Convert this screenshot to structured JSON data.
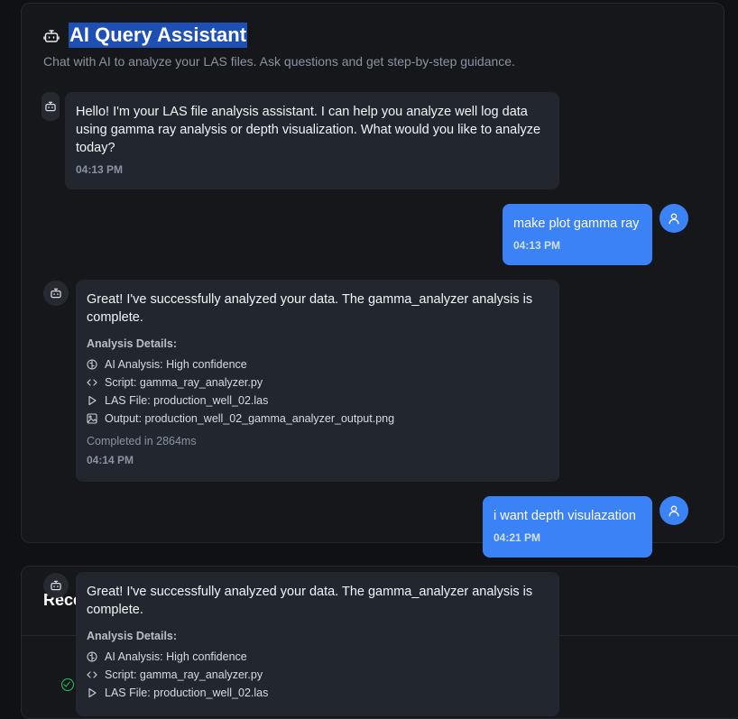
{
  "header": {
    "title": "AI Query Assistant",
    "subtitle": "Chat with AI to analyze your LAS files. Ask questions and get step-by-step guidance."
  },
  "messages": [
    {
      "role": "assistant",
      "text": "Hello! I'm your LAS file analysis assistant. I can help you analyze well log data using gamma ray analysis or depth visualization. What would you like to analyze today?",
      "time": "04:13 PM"
    },
    {
      "role": "user",
      "text": "make plot gamma ray",
      "time": "04:13 PM"
    },
    {
      "role": "assistant",
      "text": "Great! I've successfully analyzed your data. The gamma_analyzer analysis is complete.",
      "details_heading": "Analysis Details:",
      "details": [
        {
          "icon": "brain-icon",
          "label": "AI Analysis: High confidence"
        },
        {
          "icon": "code-icon",
          "label": "Script: gamma_ray_analyzer.py"
        },
        {
          "icon": "play-icon",
          "label": "LAS File: production_well_02.las"
        },
        {
          "icon": "image-icon",
          "label": "Output: production_well_02_gamma_analyzer_output.png"
        }
      ],
      "completed": "Completed in 2864ms",
      "time": "04:14 PM"
    },
    {
      "role": "user",
      "text": "i want depth visulazation",
      "time": "04:21 PM"
    },
    {
      "role": "assistant",
      "text": "Great! I've successfully analyzed your data. The gamma_analyzer analysis is complete.",
      "details_heading": "Analysis Details:",
      "details": [
        {
          "icon": "brain-icon",
          "label": "AI Analysis: High confidence"
        },
        {
          "icon": "code-icon",
          "label": "Script: gamma_ray_analyzer.py"
        },
        {
          "icon": "play-icon",
          "label": "LAS File: production_well_02.las"
        }
      ]
    }
  ],
  "recent": {
    "title": "Rece"
  },
  "colors": {
    "accent": "#3b82f6",
    "success": "#22c55e",
    "highlight": "#1d4fb5"
  }
}
